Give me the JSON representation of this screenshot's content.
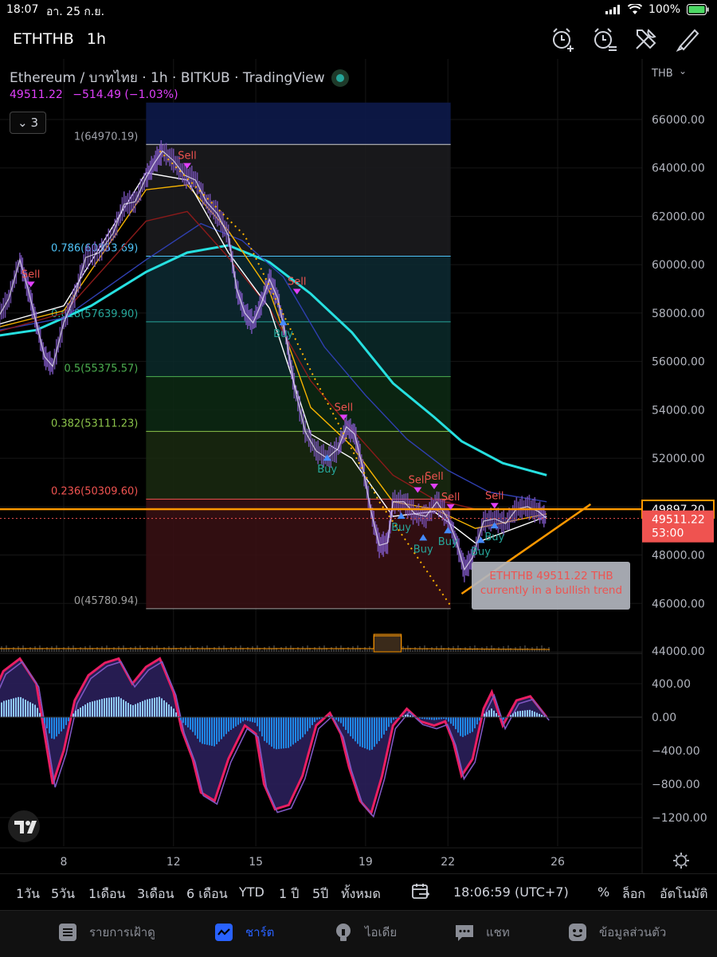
{
  "status": {
    "time": "18:07",
    "date": "อา. 25 ก.ย.",
    "battery": "100%"
  },
  "header": {
    "symbol": "ETHTHB",
    "interval": "1h"
  },
  "icons": [
    "alarm-add-icon",
    "alarm-list-icon",
    "tools-icon",
    "draw-icon"
  ],
  "legend": {
    "title": "Ethereum / บาทไทย · 1h · BITKUB · TradingView",
    "price": "49511.22",
    "change": "−514.49 (−1.03%)",
    "collapse_count": "3"
  },
  "colors": {
    "accent": "#2962ff",
    "price_line": "#ff9800",
    "up": "#26a69a",
    "down": "#ef5350",
    "ma_cyan": "#26e0e0",
    "candles": "#7e57c2",
    "fib_text": "#a0a3ab"
  },
  "chart_data": [
    {
      "type": "candlestick",
      "title": "Ethereum / บาทไทย · 1h · BITKUB · TradingView",
      "x_ticks": [
        "8",
        "12",
        "15",
        "19",
        "22",
        "26"
      ],
      "y_ticks": [
        44000,
        46000,
        48000,
        50000,
        52000,
        54000,
        56000,
        58000,
        60000,
        62000,
        64000,
        66000
      ],
      "y_labels": [
        "44000.00",
        "46000.00",
        "48000.00",
        "50000.00",
        "52000.00",
        "54000.00",
        "56000.00",
        "58000.00",
        "60000.00",
        "62000.00",
        "64000.00",
        "66000.00"
      ],
      "ylim": [
        43950,
        66800
      ],
      "currency": "THB",
      "price_path": [
        [
          5.2,
          57200
        ],
        [
          5.6,
          57800
        ],
        [
          6.0,
          58600
        ],
        [
          6.4,
          60200
        ],
        [
          6.7,
          59000
        ],
        [
          7.0,
          57600
        ],
        [
          7.3,
          56200
        ],
        [
          7.6,
          55800
        ],
        [
          8.0,
          57600
        ],
        [
          8.4,
          58700
        ],
        [
          8.8,
          60300
        ],
        [
          9.3,
          60500
        ],
        [
          9.8,
          61300
        ],
        [
          10.2,
          62500
        ],
        [
          10.6,
          62600
        ],
        [
          11.0,
          63600
        ],
        [
          11.3,
          64200
        ],
        [
          11.6,
          64700
        ],
        [
          12.0,
          64300
        ],
        [
          12.4,
          63700
        ],
        [
          12.8,
          63500
        ],
        [
          13.2,
          62600
        ],
        [
          13.6,
          62100
        ],
        [
          14.0,
          61200
        ],
        [
          14.3,
          59000
        ],
        [
          14.6,
          58000
        ],
        [
          14.9,
          57600
        ],
        [
          15.2,
          58400
        ],
        [
          15.5,
          59400
        ],
        [
          15.8,
          58600
        ],
        [
          16.1,
          57000
        ],
        [
          16.4,
          55000
        ],
        [
          16.8,
          53100
        ],
        [
          17.2,
          52300
        ],
        [
          17.6,
          52000
        ],
        [
          18.0,
          52400
        ],
        [
          18.3,
          53300
        ],
        [
          18.6,
          53000
        ],
        [
          18.9,
          51600
        ],
        [
          19.2,
          49800
        ],
        [
          19.5,
          48400
        ],
        [
          19.8,
          48500
        ],
        [
          20.0,
          50200
        ],
        [
          20.4,
          50200
        ],
        [
          20.8,
          49700
        ],
        [
          21.2,
          49600
        ],
        [
          21.6,
          50200
        ],
        [
          22.0,
          49500
        ],
        [
          22.3,
          48600
        ],
        [
          22.6,
          47400
        ],
        [
          22.9,
          47900
        ],
        [
          23.3,
          49400
        ],
        [
          23.7,
          49500
        ],
        [
          24.1,
          49300
        ],
        [
          24.5,
          49900
        ],
        [
          24.9,
          50000
        ],
        [
          25.3,
          49800
        ],
        [
          25.6,
          49511
        ]
      ],
      "moving_averages": [
        {
          "color": "#26e0e0",
          "points": [
            [
              5.2,
              57000
            ],
            [
              7,
              57300
            ],
            [
              9,
              58300
            ],
            [
              11,
              59700
            ],
            [
              12.5,
              60500
            ],
            [
              14,
              60800
            ],
            [
              15.5,
              60100
            ],
            [
              17,
              58800
            ],
            [
              18.5,
              57200
            ],
            [
              20,
              55100
            ],
            [
              21.5,
              53700
            ],
            [
              22.5,
              52700
            ],
            [
              24,
              51800
            ],
            [
              25.6,
              51300
            ]
          ]
        },
        {
          "color": "#2f3fb0",
          "points": [
            [
              5.2,
              57200
            ],
            [
              8,
              57800
            ],
            [
              11,
              60200
            ],
            [
              13,
              61700
            ],
            [
              14.5,
              61000
            ],
            [
              16,
              59500
            ],
            [
              17.5,
              56600
            ],
            [
              19,
              54600
            ],
            [
              20.5,
              52800
            ],
            [
              22,
              51500
            ],
            [
              23.5,
              50600
            ],
            [
              25.6,
              50200
            ]
          ]
        },
        {
          "color": "#8b1a1a",
          "points": [
            [
              5.2,
              57100
            ],
            [
              8,
              58000
            ],
            [
              11,
              61800
            ],
            [
              12.5,
              62200
            ],
            [
              14,
              60300
            ],
            [
              15.5,
              58200
            ],
            [
              17,
              55200
            ],
            [
              18.5,
              53200
            ],
            [
              20,
              51300
            ],
            [
              21.5,
              50300
            ],
            [
              23,
              49900
            ],
            [
              25.6,
              49900
            ]
          ]
        },
        {
          "color": "#f5b301",
          "points": [
            [
              5.2,
              57300
            ],
            [
              8,
              58100
            ],
            [
              11,
              63100
            ],
            [
              12.5,
              63300
            ],
            [
              14,
              61400
            ],
            [
              15.5,
              58900
            ],
            [
              17,
              54100
            ],
            [
              18.5,
              52500
            ],
            [
              20,
              50200
            ],
            [
              21.5,
              49900
            ],
            [
              23,
              49100
            ],
            [
              25.6,
              49700
            ]
          ]
        },
        {
          "color": "#ffffff",
          "points": [
            [
              5.2,
              57400
            ],
            [
              8,
              58300
            ],
            [
              11,
              63800
            ],
            [
              12.5,
              63500
            ],
            [
              14,
              60500
            ],
            [
              15.5,
              58200
            ],
            [
              17,
              53000
            ],
            [
              18.5,
              52000
            ],
            [
              20,
              49600
            ],
            [
              21.5,
              49800
            ],
            [
              23,
              48500
            ],
            [
              25.6,
              49600
            ]
          ]
        }
      ],
      "fib_levels": [
        {
          "label": "1(64970.19)",
          "value": 64970.19,
          "fill": "#1c1c20",
          "line": "#d0d0d0"
        },
        {
          "label": "0.786(60353.69)",
          "value": 60353.69,
          "fill": "#0d2a33",
          "line": "#4fc3f7"
        },
        {
          "label": "0.618(57639.90)",
          "value": 57639.9,
          "fill": "#0b2a2a",
          "line": "#26a69a"
        },
        {
          "label": "0.5(55375.57)",
          "value": 55375.57,
          "fill": "#0d2a14",
          "line": "#4caf50"
        },
        {
          "label": "0.382(53111.23)",
          "value": 53111.23,
          "fill": "#1a2a10",
          "line": "#8bc34a"
        },
        {
          "label": "0.236(50309.60)",
          "value": 50309.6,
          "fill": "#3a1014",
          "line": "#ef5350"
        },
        {
          "label": "0(45780.94)",
          "value": 45780.94,
          "fill": null,
          "line": "#9e9e9e"
        }
      ],
      "fib_range_x": [
        11,
        22.1
      ],
      "fib_top_fill": {
        "value": 66700,
        "color": "#0d1a4a"
      },
      "horizontal_line": {
        "value": 49897.2,
        "label": "49897.20",
        "color": "#ff9800"
      },
      "last_price": {
        "value": 49511.22,
        "label": "49511.22",
        "countdown": "53:00",
        "color": "#ef5350"
      },
      "trend_dotted": [
        [
          11.5,
          64700
        ],
        [
          14.6,
          61200
        ],
        [
          17.1,
          55400
        ],
        [
          19.5,
          50200
        ],
        [
          22.1,
          45900
        ]
      ],
      "trend_support": [
        [
          22.5,
          46400
        ],
        [
          27.2,
          50100
        ]
      ],
      "signals": [
        {
          "text": "Sell",
          "x": 12.5,
          "y": 64200,
          "color": "#ef5350"
        },
        {
          "text": "Sell",
          "x": 6.8,
          "y": 59300,
          "color": "#ef5350"
        },
        {
          "text": "Sell",
          "x": 16.5,
          "y": 59000,
          "color": "#ef5350"
        },
        {
          "text": "Sell",
          "x": 18.2,
          "y": 53800,
          "color": "#ef5350"
        },
        {
          "text": "Sell",
          "x": 20.9,
          "y": 50800,
          "color": "#ef5350"
        },
        {
          "text": "Sell",
          "x": 21.5,
          "y": 50950,
          "color": "#ef5350"
        },
        {
          "text": "Sell",
          "x": 22.1,
          "y": 50100,
          "color": "#ef5350"
        },
        {
          "text": "Sell",
          "x": 23.7,
          "y": 50150,
          "color": "#ef5350"
        },
        {
          "text": "Buy",
          "x": 16.0,
          "y": 57500,
          "color": "#26a69a"
        },
        {
          "text": "Buy",
          "x": 17.6,
          "y": 51900,
          "color": "#26a69a"
        },
        {
          "text": "Buy",
          "x": 20.3,
          "y": 49500,
          "color": "#26a69a"
        },
        {
          "text": "Buy",
          "x": 21.1,
          "y": 48600,
          "color": "#26a69a"
        },
        {
          "text": "Buy",
          "x": 22.0,
          "y": 48900,
          "color": "#26a69a"
        },
        {
          "text": "Buy",
          "x": 23.2,
          "y": 48500,
          "color": "#26a69a"
        },
        {
          "text": "Buy",
          "x": 23.7,
          "y": 49100,
          "color": "#26a69a"
        }
      ],
      "annotation": {
        "text": [
          "ETHTHB 49511.22 THB",
          "currently in a bullish trend"
        ],
        "color": "#ef5350"
      },
      "volume_spike": {
        "x": [
          19.3,
          20.3
        ],
        "height": 0.7
      }
    },
    {
      "type": "area",
      "title": "",
      "y_ticks": [
        400,
        0,
        -400,
        -800,
        -1200
      ],
      "y_labels": [
        "400.00",
        "0.00",
        "−400.00",
        "−800.00",
        "−1200.00"
      ],
      "ylim": [
        -1380,
        720
      ],
      "series": [
        {
          "points": [
            [
              5.2,
              100
            ],
            [
              5.8,
              550
            ],
            [
              6.4,
              700
            ],
            [
              7.0,
              400
            ],
            [
              7.3,
              -200
            ],
            [
              7.6,
              -800
            ],
            [
              8.0,
              -400
            ],
            [
              8.4,
              200
            ],
            [
              8.9,
              500
            ],
            [
              9.5,
              650
            ],
            [
              10.0,
              700
            ],
            [
              10.5,
              400
            ],
            [
              11.0,
              600
            ],
            [
              11.5,
              700
            ],
            [
              12.0,
              300
            ],
            [
              12.3,
              -150
            ],
            [
              12.7,
              -500
            ],
            [
              13.0,
              -900
            ],
            [
              13.5,
              -1000
            ],
            [
              14.0,
              -500
            ],
            [
              14.6,
              -100
            ],
            [
              15.0,
              -200
            ],
            [
              15.3,
              -800
            ],
            [
              15.7,
              -1100
            ],
            [
              16.2,
              -1050
            ],
            [
              16.7,
              -700
            ],
            [
              17.2,
              -100
            ],
            [
              17.7,
              50
            ],
            [
              18.1,
              -200
            ],
            [
              18.4,
              -600
            ],
            [
              18.8,
              -1000
            ],
            [
              19.2,
              -1150
            ],
            [
              19.6,
              -700
            ],
            [
              20.0,
              -100
            ],
            [
              20.5,
              100
            ],
            [
              21.0,
              -50
            ],
            [
              21.5,
              -100
            ],
            [
              21.9,
              -50
            ],
            [
              22.2,
              -300
            ],
            [
              22.5,
              -700
            ],
            [
              22.9,
              -500
            ],
            [
              23.3,
              100
            ],
            [
              23.6,
              300
            ],
            [
              24.0,
              -100
            ],
            [
              24.5,
              200
            ],
            [
              25.0,
              250
            ],
            [
              25.6,
              0
            ]
          ]
        }
      ]
    }
  ],
  "volume_axis_label": "44000.00",
  "range_bar": {
    "items": [
      "1วัน",
      "5วัน",
      "1เดือน",
      "3เดือน",
      "6 เดือน",
      "YTD",
      "1 ปี",
      "5ปี",
      "ทั้งหมด"
    ],
    "clock": "18:06:59 (UTC+7)",
    "percent": "%",
    "log": "ล็อก",
    "auto": "อัตโนมัติ"
  },
  "tabs": [
    {
      "label": "รายการเฝ้าดู",
      "icon": "watchlist-icon"
    },
    {
      "label": "ชาร์ต",
      "icon": "chart-icon"
    },
    {
      "label": "ไอเดีย",
      "icon": "ideas-icon"
    },
    {
      "label": "แชท",
      "icon": "chat-icon"
    },
    {
      "label": "ข้อมูลส่วนตัว",
      "icon": "profile-icon"
    }
  ]
}
